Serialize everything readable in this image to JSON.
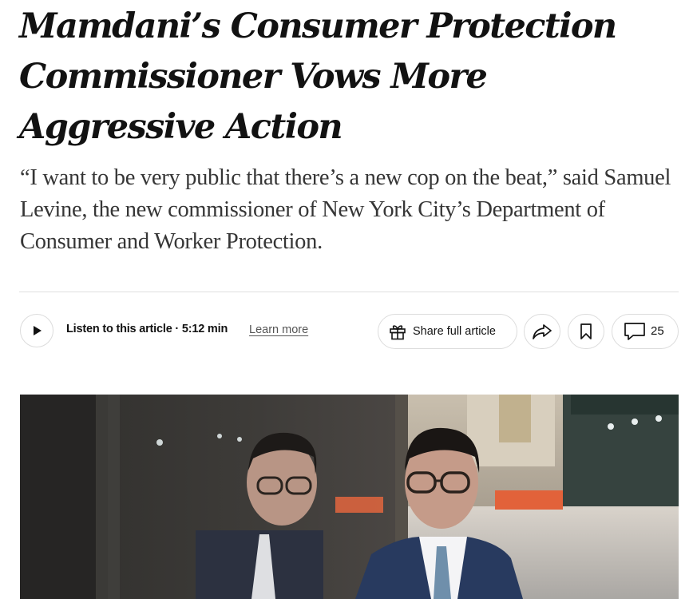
{
  "article": {
    "headline": "Mamdani’s Consumer Protection Commissioner Vows More Aggressive Action",
    "summary": "“I want to be very public that there’s a new cop on the beat,” said Samuel Levine, the new commissioner of New York City’s Department of Consumer and Worker Protection."
  },
  "toolbar": {
    "listen_label": "Listen to this article",
    "separator": " · ",
    "duration": "5:12 min",
    "learn_more": "Learn more",
    "share_full_label": "Share full article",
    "comment_count": "25"
  },
  "icons": {
    "play": "play-icon",
    "gift": "gift-icon",
    "share": "share-arrow-icon",
    "bookmark": "bookmark-icon",
    "comment": "comment-bubble-icon"
  },
  "colors": {
    "text": "#121212",
    "summary_text": "#363636",
    "divider": "#dfdfdf",
    "button_border": "#dcdcdc",
    "barrier_orange": "#e2623a"
  }
}
